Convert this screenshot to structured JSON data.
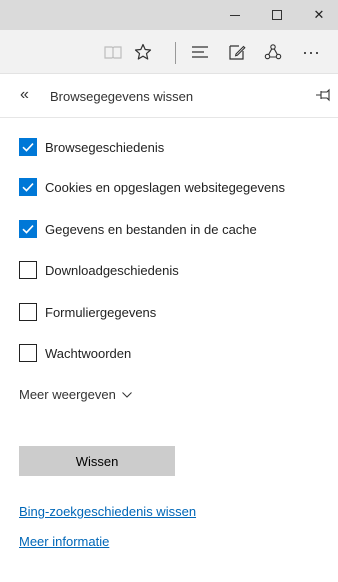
{
  "window": {
    "minimize_icon": "minimize-icon",
    "maximize_icon": "maximize-icon",
    "close_icon": "close-icon",
    "close_glyph": "✕"
  },
  "toolbar": {
    "reading_icon": "reading-view-icon",
    "favorite_icon": "star-icon",
    "hub_icon": "hub-icon",
    "note_icon": "web-note-icon",
    "share_icon": "share-icon",
    "more_icon": "more-icon",
    "more_glyph": "···"
  },
  "pane": {
    "back_glyph": "«",
    "title": "Browsegegevens wissen",
    "pin_icon": "pin-icon"
  },
  "options": [
    {
      "label": "Browsegeschiedenis",
      "checked": true
    },
    {
      "label": "Cookies en opgeslagen websitegegevens",
      "checked": true
    },
    {
      "label": "Gegevens en bestanden in de cache",
      "checked": true
    },
    {
      "label": "Downloadgeschiedenis",
      "checked": false
    },
    {
      "label": "Formuliergegevens",
      "checked": false
    },
    {
      "label": "Wachtwoorden",
      "checked": false
    }
  ],
  "show_more": "Meer weergeven",
  "clear_button": "Wissen",
  "links": {
    "bing_history": "Bing-zoekgeschiedenis wissen",
    "more_info": "Meer informatie"
  },
  "colors": {
    "accent": "#0078d7",
    "link": "#0067b8",
    "titlebar": "#dadada",
    "toolbar": "#f2f2f2",
    "button": "#cccccc"
  }
}
